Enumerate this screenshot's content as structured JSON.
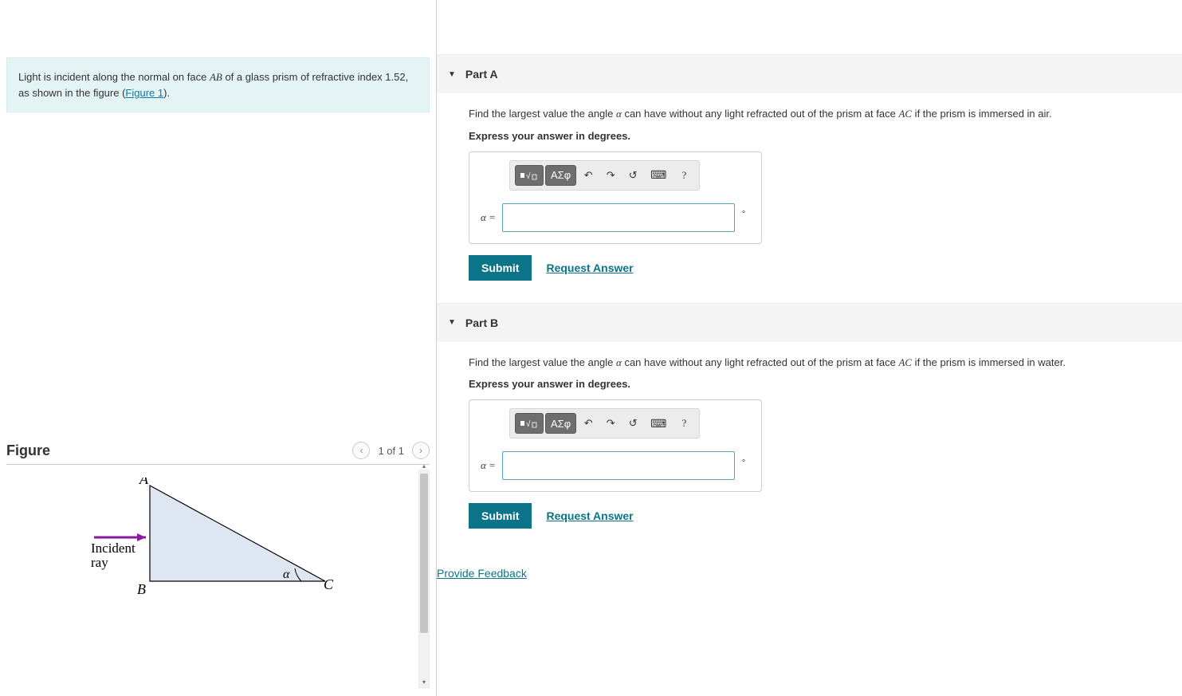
{
  "problem": {
    "intro_prefix": "Light is incident along the normal on face ",
    "intro_face1": "AB",
    "intro_mid": " of a glass prism of refractive index 1.52, as shown in the figure (",
    "figure_link": "Figure 1",
    "intro_suffix": ")."
  },
  "figure": {
    "title": "Figure",
    "page_indicator": "1 of 1",
    "labels": {
      "A": "A",
      "B": "B",
      "C": "C",
      "alpha": "α",
      "incident": "Incident",
      "ray": "ray"
    }
  },
  "partA": {
    "header": "Part A",
    "q_prefix": "Find the largest value the angle ",
    "q_alpha": "α",
    "q_mid": " can have without any light refracted out of the prism at face ",
    "q_face": "AC",
    "q_suffix": " if the prism is immersed in air.",
    "instruction": "Express your answer in degrees.",
    "alpha_eq": "α =",
    "unit": "∘",
    "submit": "Submit",
    "request": "Request Answer",
    "toolbar_greek": "ΑΣφ",
    "answer_value": ""
  },
  "partB": {
    "header": "Part B",
    "q_prefix": "Find the largest value the angle ",
    "q_alpha": "α",
    "q_mid": " can have without any light refracted out of the prism at face ",
    "q_face": "AC",
    "q_suffix": " if the prism is immersed in water.",
    "instruction": "Express your answer in degrees.",
    "alpha_eq": "α =",
    "unit": "∘",
    "submit": "Submit",
    "request": "Request Answer",
    "toolbar_greek": "ΑΣφ",
    "answer_value": ""
  },
  "feedback": "Provide Feedback"
}
